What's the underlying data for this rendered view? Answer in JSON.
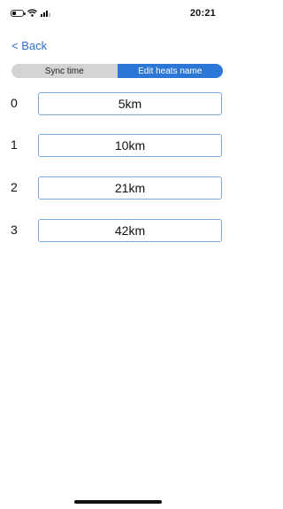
{
  "status_bar": {
    "time": "20:21"
  },
  "nav": {
    "back_label": "< Back"
  },
  "segments": [
    {
      "label": "Sync time",
      "selected": false
    },
    {
      "label": "Edit heats name",
      "selected": true
    }
  ],
  "heats": [
    {
      "index": "0",
      "name": "5km"
    },
    {
      "index": "1",
      "name": "10km"
    },
    {
      "index": "2",
      "name": "21km"
    },
    {
      "index": "3",
      "name": "42km"
    }
  ],
  "colors": {
    "accent": "#2c77d6",
    "link": "#2b6fc9",
    "segment_inactive": "#d4d4d7",
    "input_border": "#7ea8d6"
  },
  "icons": [
    "battery-icon",
    "wifi-icon",
    "cellular-signal-icon"
  ]
}
